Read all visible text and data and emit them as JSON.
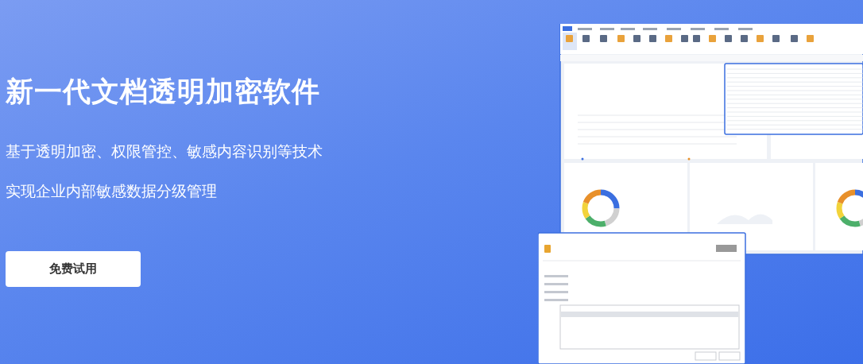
{
  "hero": {
    "headline": "新一代文档透明加密软件",
    "lines": [
      "基于透明加密、权限管控、敏感内容识别等技术",
      "实现企业内部敏感数据分级管理"
    ],
    "button": "免费试用"
  }
}
